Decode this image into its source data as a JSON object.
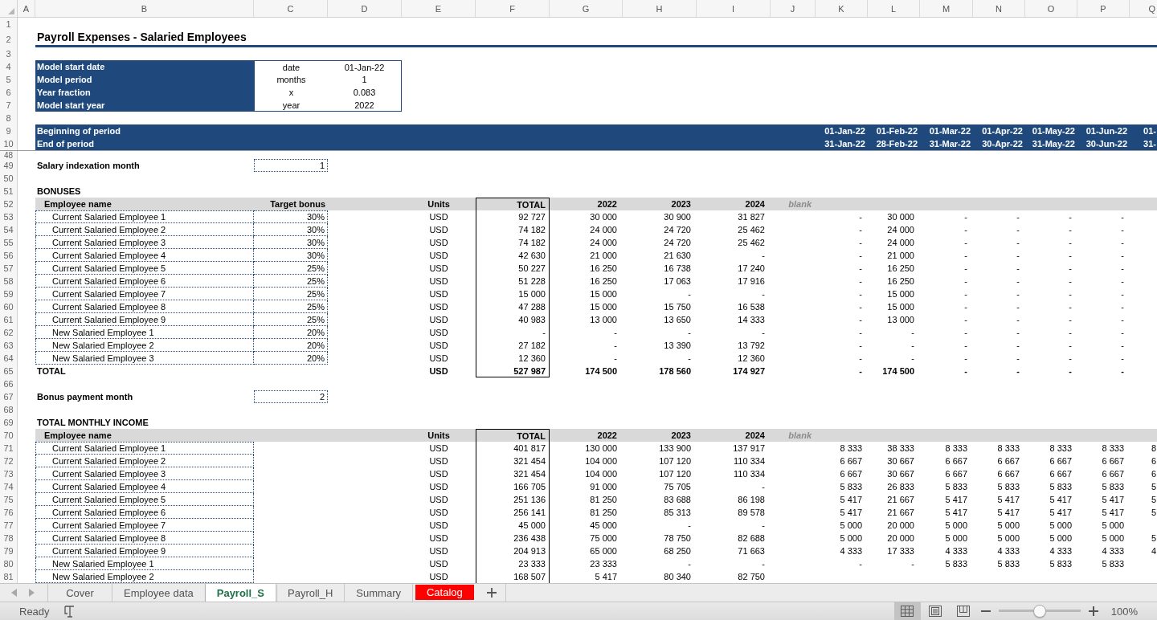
{
  "columns": [
    "A",
    "B",
    "C",
    "D",
    "E",
    "F",
    "G",
    "H",
    "I",
    "J",
    "K",
    "L",
    "M",
    "N",
    "O",
    "P",
    "Q"
  ],
  "rows": [
    {
      "number": "1",
      "kind": "blank"
    },
    {
      "number": "2",
      "kind": "title",
      "text": "Payroll Expenses - Salaried Employees"
    },
    {
      "number": "3",
      "kind": "blank"
    },
    {
      "number": "4",
      "kind": "parameter",
      "label": "Model start date",
      "unit": "date",
      "value": "01-Jan-22"
    },
    {
      "number": "5",
      "kind": "parameter",
      "label": "Model period",
      "unit": "months",
      "value": "1"
    },
    {
      "number": "6",
      "kind": "parameter",
      "label": "Year fraction",
      "unit": "x",
      "value": "0.083"
    },
    {
      "number": "7",
      "kind": "parameter",
      "label": "Model start year",
      "unit": "year",
      "value": "2022"
    },
    {
      "number": "8",
      "kind": "blank"
    },
    {
      "number": "9",
      "kind": "period",
      "label": "Beginning of period",
      "dates": [
        "01-Jan-22",
        "01-Feb-22",
        "01-Mar-22",
        "01-Apr-22",
        "01-May-22",
        "01-Jun-22",
        "01-"
      ]
    },
    {
      "number": "10",
      "kind": "period",
      "label": "End of period",
      "dates": [
        "31-Jan-22",
        "28-Feb-22",
        "31-Mar-22",
        "30-Apr-22",
        "31-May-22",
        "30-Jun-22",
        "31-"
      ]
    },
    {
      "number": "48",
      "kind": "sliver"
    },
    {
      "number": "49",
      "kind": "input",
      "label": "Salary indexation month",
      "value": "1"
    },
    {
      "number": "50",
      "kind": "blank"
    },
    {
      "number": "51",
      "kind": "section",
      "label": "BONUSES"
    },
    {
      "number": "52",
      "kind": "header",
      "name": "Employee name",
      "target": "Target bonus",
      "units": "Units",
      "total": "TOTAL",
      "years": [
        "2022",
        "2023",
        "2024"
      ],
      "note": "blank"
    },
    {
      "number": "53",
      "kind": "employee",
      "name": "Current Salaried Employee 1",
      "target": "30%",
      "units": "USD",
      "total": "92 727",
      "years": [
        "30 000",
        "30 900",
        "31 827"
      ],
      "months": [
        "-",
        "30 000",
        "-",
        "-",
        "-",
        "-"
      ]
    },
    {
      "number": "54",
      "kind": "employee",
      "name": "Current Salaried Employee 2",
      "target": "30%",
      "units": "USD",
      "total": "74 182",
      "years": [
        "24 000",
        "24 720",
        "25 462"
      ],
      "months": [
        "-",
        "24 000",
        "-",
        "-",
        "-",
        "-"
      ]
    },
    {
      "number": "55",
      "kind": "employee",
      "name": "Current Salaried Employee 3",
      "target": "30%",
      "units": "USD",
      "total": "74 182",
      "years": [
        "24 000",
        "24 720",
        "25 462"
      ],
      "months": [
        "-",
        "24 000",
        "-",
        "-",
        "-",
        "-"
      ]
    },
    {
      "number": "56",
      "kind": "employee",
      "name": "Current Salaried Employee 4",
      "target": "30%",
      "units": "USD",
      "total": "42 630",
      "years": [
        "21 000",
        "21 630",
        "-"
      ],
      "months": [
        "-",
        "21 000",
        "-",
        "-",
        "-",
        "-"
      ]
    },
    {
      "number": "57",
      "kind": "employee",
      "name": "Current Salaried Employee 5",
      "target": "25%",
      "units": "USD",
      "total": "50 227",
      "years": [
        "16 250",
        "16 738",
        "17 240"
      ],
      "months": [
        "-",
        "16 250",
        "-",
        "-",
        "-",
        "-"
      ]
    },
    {
      "number": "58",
      "kind": "employee",
      "name": "Current Salaried Employee 6",
      "target": "25%",
      "units": "USD",
      "total": "51 228",
      "years": [
        "16 250",
        "17 063",
        "17 916"
      ],
      "months": [
        "-",
        "16 250",
        "-",
        "-",
        "-",
        "-"
      ]
    },
    {
      "number": "59",
      "kind": "employee",
      "name": "Current Salaried Employee 7",
      "target": "25%",
      "units": "USD",
      "total": "15 000",
      "years": [
        "15 000",
        "-",
        "-"
      ],
      "months": [
        "-",
        "15 000",
        "-",
        "-",
        "-",
        "-"
      ]
    },
    {
      "number": "60",
      "kind": "employee",
      "name": "Current Salaried Employee 8",
      "target": "25%",
      "units": "USD",
      "total": "47 288",
      "years": [
        "15 000",
        "15 750",
        "16 538"
      ],
      "months": [
        "-",
        "15 000",
        "-",
        "-",
        "-",
        "-"
      ]
    },
    {
      "number": "61",
      "kind": "employee",
      "name": "Current Salaried Employee 9",
      "target": "25%",
      "units": "USD",
      "total": "40 983",
      "years": [
        "13 000",
        "13 650",
        "14 333"
      ],
      "months": [
        "-",
        "13 000",
        "-",
        "-",
        "-",
        "-"
      ]
    },
    {
      "number": "62",
      "kind": "employee",
      "name": "New Salaried Employee 1",
      "target": "20%",
      "units": "USD",
      "total": "-",
      "years": [
        "-",
        "-",
        "-"
      ],
      "months": [
        "-",
        "-",
        "-",
        "-",
        "-",
        "-"
      ]
    },
    {
      "number": "63",
      "kind": "employee",
      "name": "New Salaried Employee 2",
      "target": "20%",
      "units": "USD",
      "total": "27 182",
      "years": [
        "-",
        "13 390",
        "13 792"
      ],
      "months": [
        "-",
        "-",
        "-",
        "-",
        "-",
        "-"
      ]
    },
    {
      "number": "64",
      "kind": "employee",
      "name": "New Salaried Employee 3",
      "target": "20%",
      "units": "USD",
      "total": "12 360",
      "years": [
        "-",
        "-",
        "12 360"
      ],
      "months": [
        "-",
        "-",
        "-",
        "-",
        "-",
        "-"
      ]
    },
    {
      "number": "65",
      "kind": "total",
      "name": "TOTAL",
      "units": "USD",
      "total": "527 987",
      "years": [
        "174 500",
        "178 560",
        "174 927"
      ],
      "months": [
        "-",
        "174 500",
        "-",
        "-",
        "-",
        "-"
      ]
    },
    {
      "number": "66",
      "kind": "blank"
    },
    {
      "number": "67",
      "kind": "input",
      "label": "Bonus payment month",
      "value": "2"
    },
    {
      "number": "68",
      "kind": "blank"
    },
    {
      "number": "69",
      "kind": "section",
      "label": "TOTAL MONTHLY INCOME"
    },
    {
      "number": "70",
      "kind": "header",
      "name": "Employee name",
      "units": "Units",
      "total": "TOTAL",
      "years": [
        "2022",
        "2023",
        "2024"
      ],
      "note": "blank"
    },
    {
      "number": "71",
      "kind": "employee",
      "name": "Current Salaried Employee 1",
      "units": "USD",
      "total": "401 817",
      "years": [
        "130 000",
        "133 900",
        "137 917"
      ],
      "months": [
        "8 333",
        "38 333",
        "8 333",
        "8 333",
        "8 333",
        "8 333",
        "8"
      ]
    },
    {
      "number": "72",
      "kind": "employee",
      "name": "Current Salaried Employee 2",
      "units": "USD",
      "total": "321 454",
      "years": [
        "104 000",
        "107 120",
        "110 334"
      ],
      "months": [
        "6 667",
        "30 667",
        "6 667",
        "6 667",
        "6 667",
        "6 667",
        "6"
      ]
    },
    {
      "number": "73",
      "kind": "employee",
      "name": "Current Salaried Employee 3",
      "units": "USD",
      "total": "321 454",
      "years": [
        "104 000",
        "107 120",
        "110 334"
      ],
      "months": [
        "6 667",
        "30 667",
        "6 667",
        "6 667",
        "6 667",
        "6 667",
        "6"
      ]
    },
    {
      "number": "74",
      "kind": "employee",
      "name": "Current Salaried Employee 4",
      "units": "USD",
      "total": "166 705",
      "years": [
        "91 000",
        "75 705",
        "-"
      ],
      "months": [
        "5 833",
        "26 833",
        "5 833",
        "5 833",
        "5 833",
        "5 833",
        "5"
      ]
    },
    {
      "number": "75",
      "kind": "employee",
      "name": "Current Salaried Employee 5",
      "units": "USD",
      "total": "251 136",
      "years": [
        "81 250",
        "83 688",
        "86 198"
      ],
      "months": [
        "5 417",
        "21 667",
        "5 417",
        "5 417",
        "5 417",
        "5 417",
        "5"
      ]
    },
    {
      "number": "76",
      "kind": "employee",
      "name": "Current Salaried Employee 6",
      "units": "USD",
      "total": "256 141",
      "years": [
        "81 250",
        "85 313",
        "89 578"
      ],
      "months": [
        "5 417",
        "21 667",
        "5 417",
        "5 417",
        "5 417",
        "5 417",
        "5"
      ]
    },
    {
      "number": "77",
      "kind": "employee",
      "name": "Current Salaried Employee 7",
      "units": "USD",
      "total": "45 000",
      "years": [
        "45 000",
        "-",
        "-"
      ],
      "months": [
        "5 000",
        "20 000",
        "5 000",
        "5 000",
        "5 000",
        "5 000"
      ]
    },
    {
      "number": "78",
      "kind": "employee",
      "name": "Current Salaried Employee 8",
      "units": "USD",
      "total": "236 438",
      "years": [
        "75 000",
        "78 750",
        "82 688"
      ],
      "months": [
        "5 000",
        "20 000",
        "5 000",
        "5 000",
        "5 000",
        "5 000",
        "5"
      ]
    },
    {
      "number": "79",
      "kind": "employee",
      "name": "Current Salaried Employee 9",
      "units": "USD",
      "total": "204 913",
      "years": [
        "65 000",
        "68 250",
        "71 663"
      ],
      "months": [
        "4 333",
        "17 333",
        "4 333",
        "4 333",
        "4 333",
        "4 333",
        "4"
      ]
    },
    {
      "number": "80",
      "kind": "employee",
      "name": "New Salaried Employee 1",
      "units": "USD",
      "total": "23 333",
      "years": [
        "23 333",
        "-",
        "-"
      ],
      "months": [
        "-",
        "-",
        "5 833",
        "5 833",
        "5 833",
        "5 833"
      ]
    },
    {
      "number": "81",
      "kind": "employee",
      "name": "New Salaried Employee 2",
      "units": "USD",
      "total": "168 507",
      "years": [
        "5 417",
        "80 340",
        "82 750"
      ],
      "months": []
    }
  ],
  "sheet_tabs": [
    {
      "label": "Cover",
      "selected": false
    },
    {
      "label": "Employee data",
      "selected": false
    },
    {
      "label": "Payroll_S",
      "selected": true
    },
    {
      "label": "Payroll_H",
      "selected": false
    },
    {
      "label": "Summary",
      "selected": false
    },
    {
      "label": "Catalog",
      "selected": false,
      "color": "#ff0000"
    }
  ],
  "status_bar": {
    "status": "Ready",
    "views": [
      {
        "kind": "normal",
        "selected": true
      },
      {
        "kind": "page_layout",
        "selected": false
      },
      {
        "kind": "page_break",
        "selected": false
      }
    ],
    "zoom": {
      "level": 0.5,
      "reading": "100%"
    }
  }
}
